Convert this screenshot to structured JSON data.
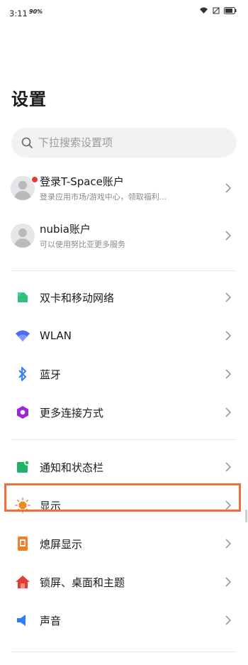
{
  "status_bar": {
    "time": "3:11",
    "network": "90%"
  },
  "title": "设置",
  "search": {
    "placeholder": "下拉搜索设置项"
  },
  "accounts": [
    {
      "label": "登录T-Space账户",
      "sub": "登录应用市场/游戏中心，领取福利...",
      "badge": true
    },
    {
      "label": "nubia账户",
      "sub": "可以使用努比亚更多服务",
      "badge": false
    }
  ],
  "group1": [
    {
      "label": "双卡和移动网络",
      "icon": "sim-card-icon",
      "color": "#2ec27e"
    },
    {
      "label": "WLAN",
      "icon": "wifi-icon",
      "color": "#4a6cf7"
    },
    {
      "label": "蓝牙",
      "icon": "bluetooth-icon",
      "color": "#3b7ff5"
    },
    {
      "label": "更多连接方式",
      "icon": "more-connections-icon",
      "color": "#9c27d8"
    }
  ],
  "group2": [
    {
      "label": "通知和状态栏",
      "icon": "notification-icon",
      "color": "#1fb36a"
    },
    {
      "label": "显示",
      "icon": "sun-icon",
      "color": "#f08a24",
      "highlighted": true
    },
    {
      "label": "熄屏显示",
      "icon": "aod-icon",
      "color": "#f07f2a"
    },
    {
      "label": "锁屏、桌面和主题",
      "icon": "home-theme-icon",
      "color": "#e53935"
    },
    {
      "label": "声音",
      "icon": "speaker-icon",
      "color": "#2f7df6"
    }
  ]
}
